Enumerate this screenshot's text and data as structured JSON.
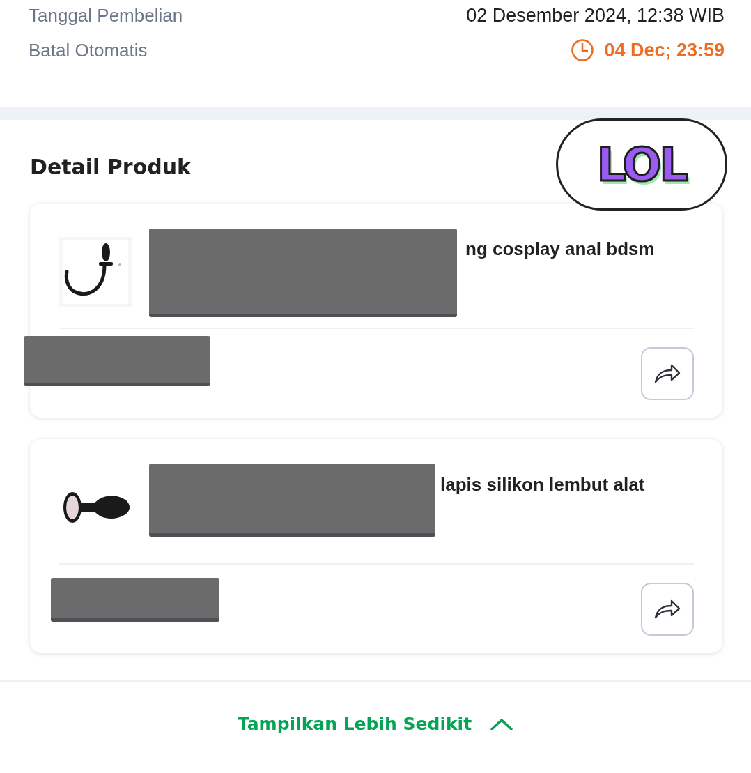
{
  "purchase_info": [
    {
      "label": "Tanggal Pembelian",
      "value": "02 Desember 2024, 12:38 WIB",
      "kind": "plain"
    },
    {
      "label": "Batal Otomatis",
      "value": "04 Dec; 23:59",
      "kind": "deadline"
    }
  ],
  "sticker": {
    "text": "LOL"
  },
  "product_section": {
    "title": "Detail Produk",
    "products": [
      {
        "title": "ng cosplay anal bdsm",
        "redacted": true
      },
      {
        "title": "lapis silikon lembut alat",
        "redacted": true
      }
    ]
  },
  "toggle": {
    "label": "Tampilkan Lebih Sedikit",
    "expanded": true
  }
}
